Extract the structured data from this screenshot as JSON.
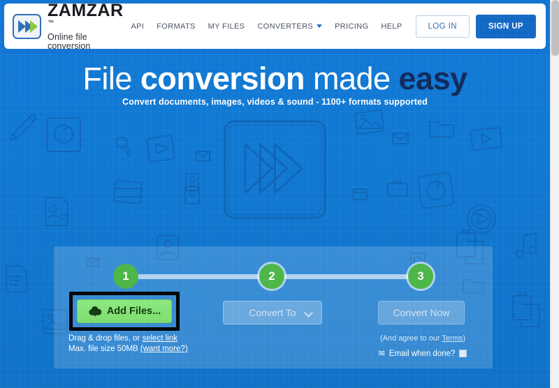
{
  "brand": {
    "name": "ZAMZAR",
    "tm": "™",
    "tagline": "Online file conversion",
    "logo_icon": "double-chevron-logo-icon",
    "accent_blue": "#1269c4",
    "accent_green": "#4cb648",
    "headline_navy": "#102a5c"
  },
  "nav": {
    "items": [
      {
        "label": "API",
        "name": "nav-item-api",
        "caret": false
      },
      {
        "label": "FORMATS",
        "name": "nav-item-formats",
        "caret": false
      },
      {
        "label": "MY FILES",
        "name": "nav-item-my-files",
        "caret": false
      },
      {
        "label": "CONVERTERS",
        "name": "nav-item-converters",
        "caret": true
      },
      {
        "label": "PRICING",
        "name": "nav-item-pricing",
        "caret": false
      },
      {
        "label": "HELP",
        "name": "nav-item-help",
        "caret": false
      }
    ],
    "login_label": "LOG IN",
    "signup_label": "SIGN UP"
  },
  "hero": {
    "headline_part1": "File ",
    "headline_part2": "conversion",
    "headline_part3": " made ",
    "headline_part4": "easy",
    "subhead": "Convert documents, images, videos & sound - 1100+ formats supported",
    "graphic_icon": "triple-chevron-convert-icon"
  },
  "converter": {
    "steps": [
      {
        "number": "1",
        "name": "step-indicator-1"
      },
      {
        "number": "2",
        "name": "step-indicator-2"
      },
      {
        "number": "3",
        "name": "step-indicator-3"
      }
    ],
    "add_files_label": "Add Files...",
    "add_files_icon": "cloud-upload-icon",
    "drag_drop_text": "Drag & drop files, or ",
    "select_link_label": "select link",
    "max_size_text": "Max. file size 50MB ",
    "want_more_label": "(want more?)",
    "convert_to_label": "Convert To",
    "convert_now_label": "Convert Now",
    "terms_prefix": "(And agree to our ",
    "terms_link_label": "Terms",
    "terms_suffix": ")",
    "email_label": "Email when done?",
    "email_icon": "envelope-icon",
    "email_checked": false
  },
  "chrome": {
    "scrollbar_name": "vertical-scrollbar",
    "scroll_thumb_name": "scrollbar-thumb"
  }
}
